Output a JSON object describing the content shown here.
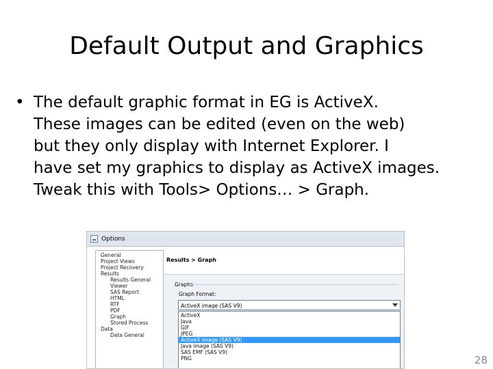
{
  "slide": {
    "title": "Default Output and Graphics",
    "bullet_symbol": "•",
    "bullet_lines": [
      "The default graphic format in EG is ActiveX.",
      "These images can be edited (even on the web)",
      "but they only display with Internet Explorer.  I",
      "have set my graphics to display as ActiveX images.",
      "Tweak this with Tools> Options… > Graph."
    ],
    "page_number": "28"
  },
  "dialog": {
    "title": "Options",
    "tree": [
      "General",
      "Project Views",
      "Project Recovery",
      "Results",
      "Results General",
      "Viewer",
      "SAS Report",
      "HTML",
      "RTF",
      "PDF",
      "Graph",
      "Stored Process",
      "Data",
      "Data General"
    ],
    "panel_title": "Results > Graph",
    "group_label": "Graphs",
    "format_label": "Graph Format:",
    "selected_format": "ActiveX image (SAS V9)",
    "format_options": [
      "ActiveX",
      "Java",
      "GIF",
      "JPEG",
      "ActiveX image (SAS V9)",
      "Java image (SAS V9)",
      "SAS EMF (SAS V9)",
      "PNG"
    ],
    "highlighted_index": 4
  },
  "colors": {
    "selection": "#3399ff",
    "titlebar": "#dfe6ee",
    "panel": "#eef2f6"
  }
}
